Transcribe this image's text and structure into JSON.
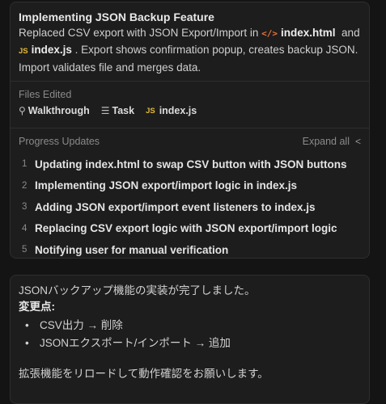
{
  "task": {
    "title": "Implementing JSON Backup Feature",
    "summary_prefix": "Replaced CSV export with JSON Export/Import in",
    "file1_icon": "</>",
    "file1": "index.html",
    "and_word": "and",
    "file2_icon": "JS",
    "file2": "index.js",
    "summary_suffix": ". Export shows confirmation popup, creates backup JSON. Import validates file and merges data."
  },
  "files_edited": {
    "label": "Files Edited",
    "items": [
      {
        "icon": "walkthrough-icon",
        "glyph": "⚲",
        "label": "Walkthrough"
      },
      {
        "icon": "task-list-icon",
        "glyph": "☰",
        "label": "Task"
      },
      {
        "icon": "js-file-icon",
        "glyph": "JS",
        "label": "index.js"
      }
    ]
  },
  "progress": {
    "label": "Progress Updates",
    "expand_label": "Expand all",
    "expand_icon": "chevron-left-icon",
    "steps": [
      {
        "num": "1",
        "text": "Updating index.html to swap CSV button with JSON buttons"
      },
      {
        "num": "2",
        "text": "Implementing JSON export/import logic in index.js"
      },
      {
        "num": "3",
        "text": "Adding JSON export/import event listeners to index.js"
      },
      {
        "num": "4",
        "text": "Replacing CSV export logic with JSON export/import logic"
      },
      {
        "num": "5",
        "text": "Notifying user for manual verification"
      }
    ]
  },
  "message": {
    "line1": "JSONバックアップ機能の実装が完了しました。",
    "changes_label": "変更点:",
    "bullets": [
      "CSV出力 → 削除",
      "JSONエクスポート/インポート → 追加"
    ],
    "closing": "拡張機能をリロードして動作確認をお願いします。"
  },
  "colors": {
    "background": "#141414",
    "card": "#1d1d1d",
    "html_icon": "#e8743b",
    "js_icon": "#e2b93b"
  }
}
